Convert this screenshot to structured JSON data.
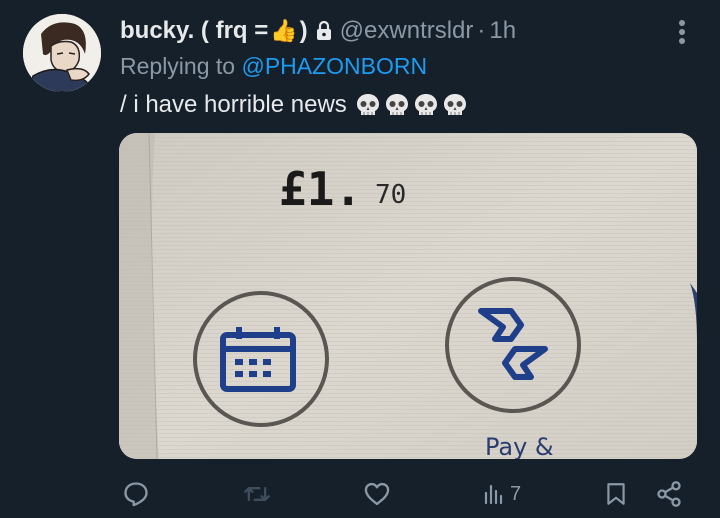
{
  "tweet": {
    "display_name": "bucky. ( frq =",
    "display_name_emoji": "👍",
    "display_name_tail": ")",
    "handle": "@exwntrsldr",
    "separator": "·",
    "time": "1h",
    "reply_prefix": "Replying to ",
    "reply_to": "@PHAZONBORN",
    "text": "/ i have horrible news",
    "text_emojis": [
      "skull",
      "skull",
      "skull",
      "skull"
    ]
  },
  "media": {
    "price_main": "£1.",
    "price_pence": "70",
    "button_label": "Pay &"
  },
  "actions": {
    "reply_icon": "reply-icon",
    "retweet_icon": "retweet-icon",
    "like_icon": "heart-icon",
    "views_icon": "views-icon",
    "views_count": "7",
    "bookmark_icon": "bookmark-icon",
    "share_icon": "share-icon"
  },
  "colors": {
    "background": "#15202b",
    "text": "#e7e9ea",
    "muted": "#8b98a5",
    "link": "#1d9bf0"
  }
}
